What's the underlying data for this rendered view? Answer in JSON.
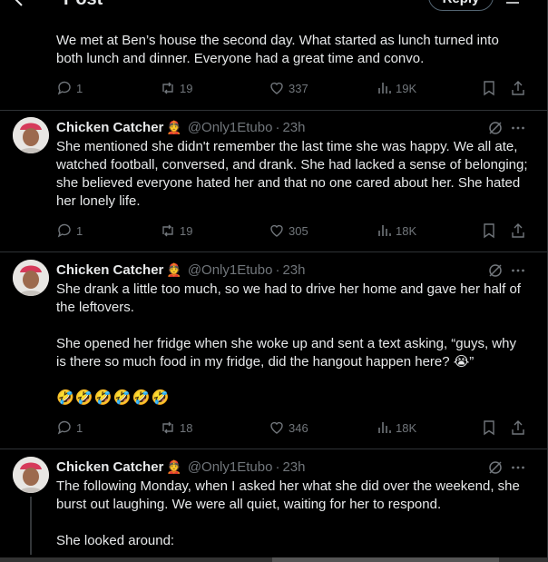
{
  "header": {
    "title": "Post",
    "reply_button": "Reply",
    "icons": [
      "back-arrow-icon",
      "settings-icon"
    ]
  },
  "tweets": [
    {
      "text": [
        "We met at Ben’s house the second day. What started as lunch turned into both lunch and dinner. Everyone had a great time and convo."
      ],
      "stats": {
        "replies": "1",
        "reposts": "19",
        "likes": "337",
        "views": "19K"
      }
    },
    {
      "author": "Chicken Catcher",
      "author_emoji": "👲",
      "handle": "@Only1Etubo",
      "time": "23h",
      "text": [
        "She mentioned she didn't remember the last time she was happy. We all ate, watched football, conversed, and drank. She had lacked a sense of belonging; she believed everyone hated her and that no one cared about her. She hated her lonely life."
      ],
      "stats": {
        "replies": "1",
        "reposts": "19",
        "likes": "305",
        "views": "18K"
      }
    },
    {
      "author": "Chicken Catcher",
      "author_emoji": "👲",
      "handle": "@Only1Etubo",
      "time": "23h",
      "text": [
        "She drank a little too much, so we had to drive her home and gave her half of the leftovers.",
        "She opened her fridge when she woke up and sent a text asking, “guys, why is there so much food in my fridge, did the hangout happen here? 😭”",
        "🤣🤣🤣🤣🤣🤣"
      ],
      "stats": {
        "replies": "1",
        "reposts": "18",
        "likes": "346",
        "views": "18K"
      }
    },
    {
      "author": "Chicken Catcher",
      "author_emoji": "👲",
      "handle": "@Only1Etubo",
      "time": "23h",
      "text": [
        "The following Monday, when I asked her what she did over the weekend, she burst out laughing. We were all quiet, waiting for her to respond.",
        "She looked around:"
      ]
    }
  ],
  "colors": {
    "background": "#000000",
    "text": "#e7e9ea",
    "muted": "#71767b",
    "divider": "#2f3336"
  }
}
